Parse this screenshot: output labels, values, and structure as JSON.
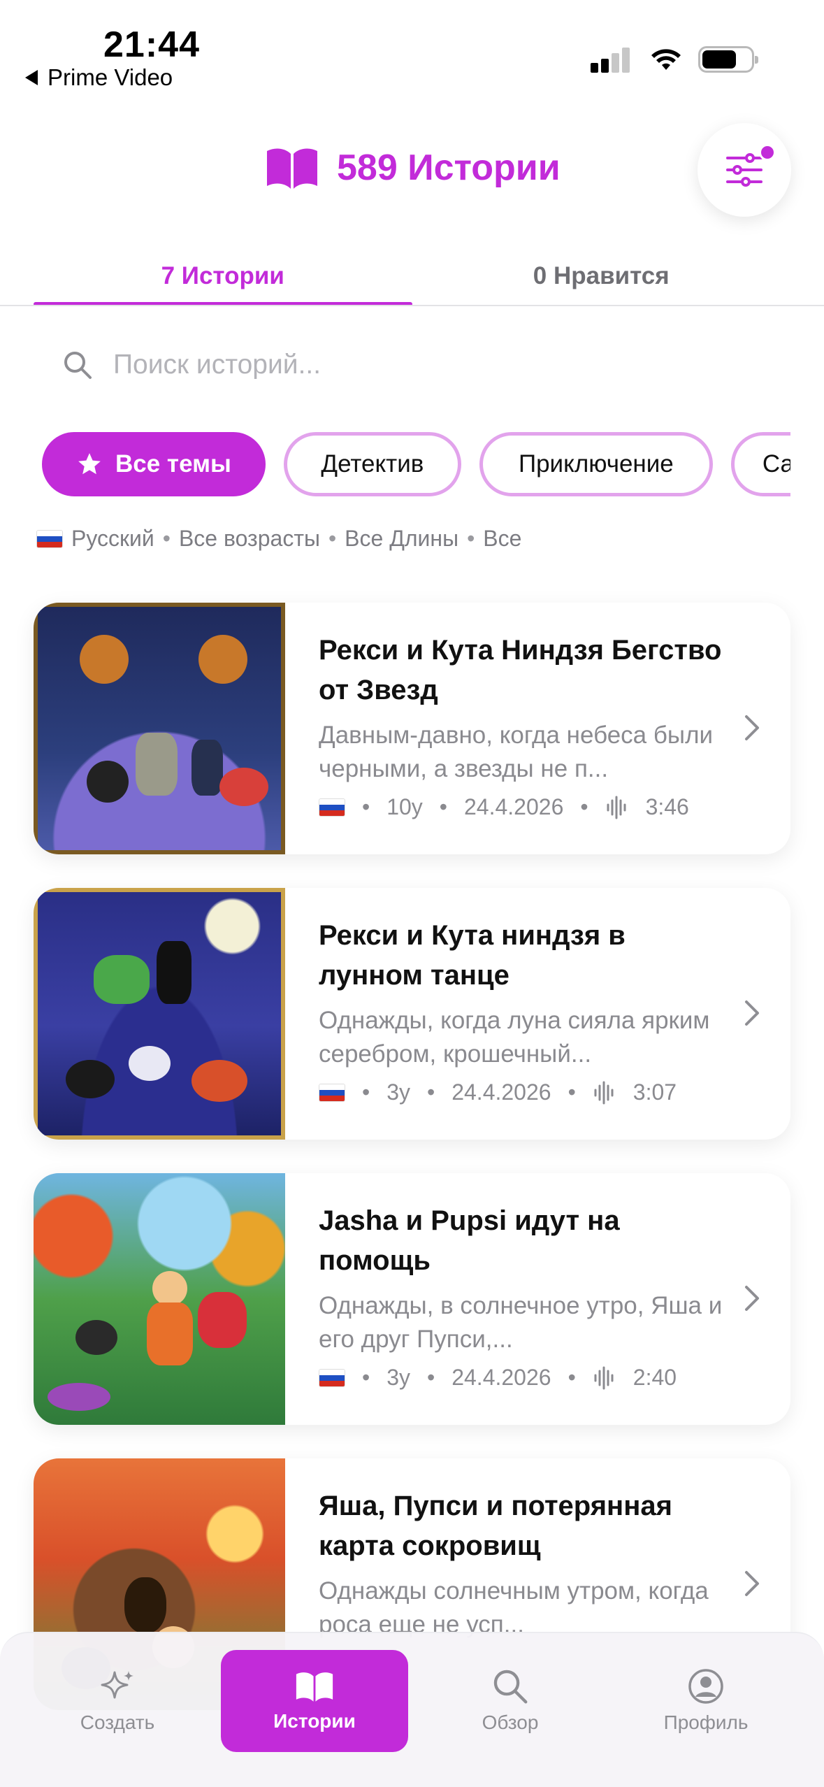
{
  "status_bar": {
    "time": "21:44",
    "back_label": "Prime Video"
  },
  "header": {
    "title": "589 Истории",
    "icon": "book-icon",
    "filter_icon": "sliders-icon",
    "filter_badge_active": true
  },
  "tabs": [
    {
      "label": "7 Истории",
      "active": true
    },
    {
      "label": "0 Нравится",
      "active": false
    }
  ],
  "search": {
    "placeholder": "Поиск историй..."
  },
  "chips": [
    {
      "label": "Все темы",
      "active": true,
      "icon": "star-icon"
    },
    {
      "label": "Детектив",
      "active": false
    },
    {
      "label": "Приключение",
      "active": false
    },
    {
      "label": "Са",
      "active": false
    }
  ],
  "filters_line": {
    "language": "Русский",
    "ages": "Все возрасты",
    "lengths": "Все Длины",
    "other": "Все",
    "separator": "•"
  },
  "stories": [
    {
      "title": "Рекси и Кута Ниндзя Бегство от Звезд",
      "description": "Давным-давно, когда небеса были черными, а звезды не п...",
      "age": "10y",
      "date": "24.4.2026",
      "duration": "3:46"
    },
    {
      "title": "Рекси и Кута ниндзя в лунном танце",
      "description": "Однажды, когда луна сияла ярким серебром, крошечный...",
      "age": "3y",
      "date": "24.4.2026",
      "duration": "3:07"
    },
    {
      "title": "Jasha и Pupsi идут на помощь",
      "description": "Однажды, в солнечное утро, Яша и его друг Пупси,...",
      "age": "3y",
      "date": "24.4.2026",
      "duration": "2:40"
    },
    {
      "title": "Яша, Пупси и потерянная карта сокровищ",
      "description": "Однажды солнечным утром, когда роса еще не усп...",
      "age": "",
      "date": "",
      "duration": ""
    }
  ],
  "bottom_nav": [
    {
      "label": "Создать",
      "icon": "sparkles-icon",
      "active": false
    },
    {
      "label": "Истории",
      "icon": "book-icon",
      "active": true
    },
    {
      "label": "Обзор",
      "icon": "search-icon",
      "active": false
    },
    {
      "label": "Профиль",
      "icon": "profile-icon",
      "active": false
    }
  ],
  "colors": {
    "accent": "#c22bd9",
    "chip_border": "#e2a3ec",
    "muted_text": "#8a8a8f"
  }
}
